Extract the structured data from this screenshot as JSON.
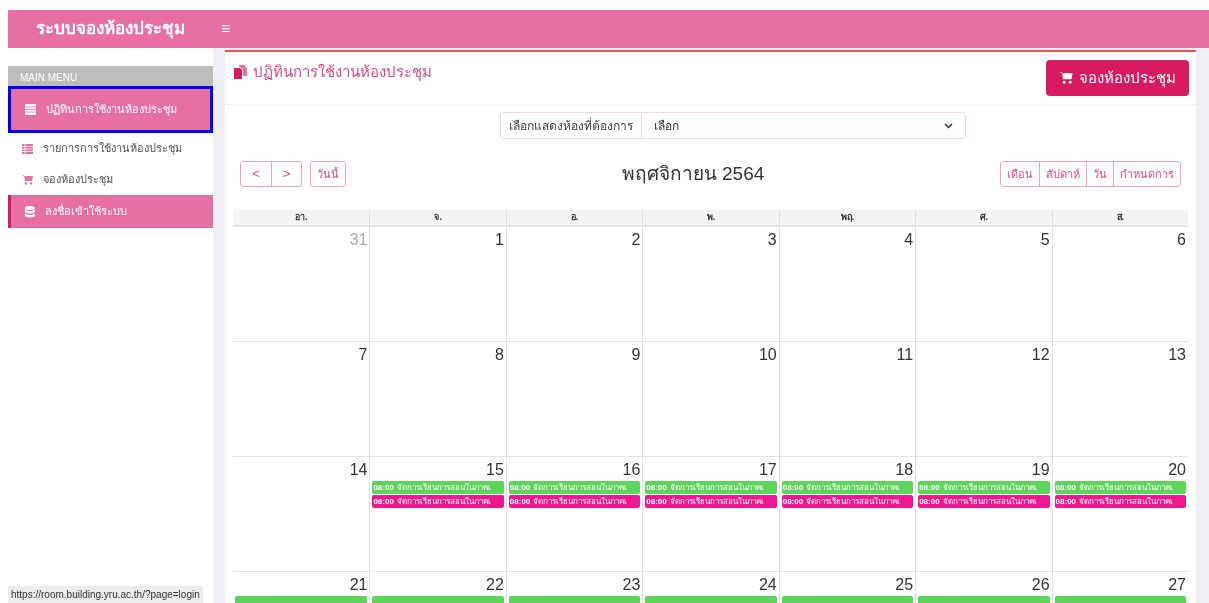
{
  "app_title": "ระบบจองห้องประชุม",
  "menu_toggle": "≡",
  "sidebar": {
    "heading": "MAIN MENU",
    "items": [
      {
        "label": "ปฏิทินการใช้งานห้องประชุม",
        "selected": true,
        "kind": "calendar"
      },
      {
        "label": "รายการการใช้งานห้องประชุม",
        "selected": false,
        "kind": "list"
      },
      {
        "label": "จองห้องประชุม",
        "selected": false,
        "kind": "booking"
      },
      {
        "label": "ลงชื่อเข้าใช้ระบบ",
        "selected": false,
        "kind": "login"
      }
    ]
  },
  "page_title": "ปฏิทินการใช้งานห้องประชุม",
  "book_button": "จองห้องประชุม",
  "room_filter": {
    "label": "เลือกแสดงห้องที่ต้องการ",
    "value": "เลือก"
  },
  "calendar": {
    "prev": "<",
    "next": ">",
    "today": "วันนี้",
    "title": "พฤศจิกายน 2564",
    "views": [
      {
        "label": "เดือน",
        "selected": false
      },
      {
        "label": "สัปดาห์",
        "selected": false
      },
      {
        "label": "วัน",
        "selected": false
      },
      {
        "label": "กำหนดการ",
        "selected": false
      }
    ],
    "weekdays": [
      "อา.",
      "จ.",
      "อ.",
      "พ.",
      "พฤ.",
      "ศ.",
      "ส."
    ],
    "weeks": [
      {
        "days": [
          {
            "day": "31",
            "other_month": true
          },
          {
            "day": "1"
          },
          {
            "day": "2"
          },
          {
            "day": "3"
          },
          {
            "day": "4"
          },
          {
            "day": "5"
          },
          {
            "day": "6"
          }
        ]
      },
      {
        "days": [
          {
            "day": "7"
          },
          {
            "day": "8"
          },
          {
            "day": "9"
          },
          {
            "day": "10"
          },
          {
            "day": "11"
          },
          {
            "day": "12"
          },
          {
            "day": "13"
          }
        ]
      },
      {
        "days": [
          {
            "day": "14"
          },
          {
            "day": "15",
            "events": [
              {
                "time": "08:00",
                "title": "จัดการเรียนการสอนในภาคเ",
                "color": "#5dd55a"
              },
              {
                "time": "08:00",
                "title": "จัดการเรียนการสอนในภาคเ",
                "color": "#f0168f"
              }
            ]
          },
          {
            "day": "16",
            "events": [
              {
                "time": "08:00",
                "title": "จัดการเรียนการสอนในภาคเ",
                "color": "#5dd55a"
              },
              {
                "time": "08:00",
                "title": "จัดการเรียนการสอนในภาคเ",
                "color": "#f0168f"
              }
            ]
          },
          {
            "day": "17",
            "events": [
              {
                "time": "08:00",
                "title": "จัดการเรียนการสอนในภาคเ",
                "color": "#5dd55a"
              },
              {
                "time": "08:00",
                "title": "จัดการเรียนการสอนในภาคเ",
                "color": "#f0168f"
              }
            ]
          },
          {
            "day": "18",
            "events": [
              {
                "time": "08:00",
                "title": "จัดการเรียนการสอนในภาคเ",
                "color": "#5dd55a"
              },
              {
                "time": "08:00",
                "title": "จัดการเรียนการสอนในภาคเ",
                "color": "#f0168f"
              }
            ]
          },
          {
            "day": "19",
            "events": [
              {
                "time": "08:00",
                "title": "จัดการเรียนการสอนในภาคเ",
                "color": "#5dd55a"
              },
              {
                "time": "08:00",
                "title": "จัดการเรียนการสอนในภาคเ",
                "color": "#f0168f"
              }
            ]
          },
          {
            "day": "20",
            "events": [
              {
                "time": "08:00",
                "title": "จัดการเรียนการสอนในภาคเ",
                "color": "#5dd55a"
              },
              {
                "time": "08:00",
                "title": "จัดการเรียนการสอนในภาคเ",
                "color": "#f0168f"
              }
            ]
          }
        ]
      },
      {
        "days": [
          {
            "day": "21",
            "events": [
              {
                "color": "#5dd55a"
              }
            ]
          },
          {
            "day": "22",
            "events": [
              {
                "color": "#5dd55a"
              }
            ]
          },
          {
            "day": "23",
            "events": [
              {
                "color": "#5dd55a"
              }
            ]
          },
          {
            "day": "24",
            "events": [
              {
                "color": "#5dd55a"
              }
            ]
          },
          {
            "day": "25",
            "events": [
              {
                "color": "#5dd55a"
              }
            ]
          },
          {
            "day": "26",
            "events": [
              {
                "color": "#5dd55a"
              }
            ]
          },
          {
            "day": "27",
            "events": [
              {
                "color": "#5dd55a"
              }
            ]
          }
        ]
      }
    ]
  },
  "status_url": "https://room.building.yru.ac.th/?page=login"
}
